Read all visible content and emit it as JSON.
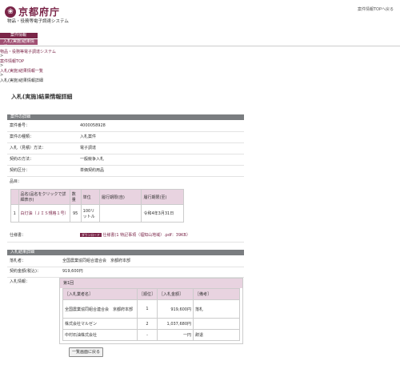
{
  "header": {
    "logo_mark": "❀",
    "logo_text": "京都府庁",
    "system_name": "物品・役務等電子調達システム",
    "top_link": "案件情報TOPへ戻る"
  },
  "nav": {
    "tab1": "案件情報",
    "tab2": "入札(実施)結果情報"
  },
  "breadcrumb": [
    "物品・役務等電子調達システム",
    ">",
    "案件情報TOP",
    ">",
    "入札(実施)結果情報一覧",
    ">",
    "入札(実施)結果情報詳細"
  ],
  "page_title": "入札(実施)結果情報詳細",
  "detail": {
    "section_title": "案件の詳細",
    "rows": [
      {
        "label": "案件番号：",
        "value": "4000058928"
      },
      {
        "label": "案件の種類：",
        "value": "入札案件"
      },
      {
        "label": "入札（見積）方法：",
        "value": "電子調達"
      },
      {
        "label": "契約の方法：",
        "value": "一般競争入札"
      },
      {
        "label": "契約区分：",
        "value": "単価契約用品"
      },
      {
        "label": "品目：",
        "value": ""
      }
    ]
  },
  "items": {
    "headers": [
      "",
      "品名(品名をクリックで詳細表示)",
      "数量",
      "単位",
      "履行期限(自)",
      "履行期限(至)"
    ],
    "rows": [
      [
        "1",
        "白灯油（ＪＩＳ規格１号）",
        "95",
        "100リットル",
        "",
        "令和4年3月31日"
      ]
    ]
  },
  "spec": {
    "label": "仕様書：",
    "tag": "ダウンロード",
    "file": "仕様書(1 特記事項（福知山地域）.pdf：39KB）"
  },
  "result": {
    "section_title": "入札結果詳細",
    "rows": [
      {
        "label": "落札者：",
        "value": "全国農業協同組合連合会　京都府本部"
      },
      {
        "label": "契約金額(税込)：",
        "value": "919,600円"
      },
      {
        "label": "入札情報：",
        "value": ""
      }
    ],
    "round": "第1回",
    "headers": [
      "［入札業者名］",
      "［順位］",
      "［入札金額］",
      "［備考］"
    ],
    "bids": [
      [
        "全国農業協同組合連合会　京都府本部",
        "1",
        "919,600円",
        "落札"
      ],
      [
        "株式会社マルゼン",
        "2",
        "1,037,680円",
        ""
      ],
      [
        "中村石油株式会社",
        "-",
        "一円",
        "辞退"
      ]
    ]
  },
  "back_button": "一覧画面に戻る"
}
